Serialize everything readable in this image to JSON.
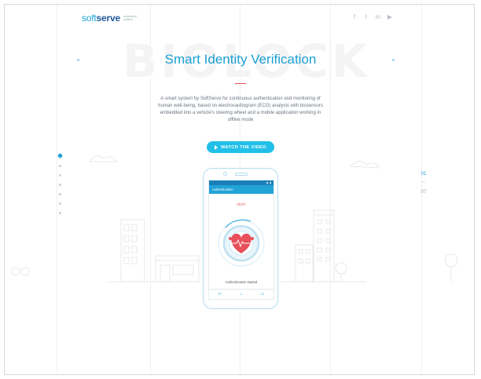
{
  "header": {
    "logo_text_soft": "soft",
    "logo_text_serve": "serve",
    "logo_tagline": "experience matters",
    "social_icons": [
      "facebook-icon",
      "twitter-icon",
      "linkedin-icon",
      "youtube-icon"
    ],
    "social_glyphs": [
      "f",
      "t",
      "in",
      "▶"
    ]
  },
  "hero": {
    "background_word": "BIOLOCK",
    "title": "Smart Identity Verification",
    "description": "A smart system by SoftServe for continuous authentication and monitoring of human well-being, based on electrocardiogram (ECG) analysis with biosensors embedded into a vehicle's steering wheel and a mobile application working in offline mode",
    "cta_label": "WATCH THE VIDEO"
  },
  "slides": {
    "current": "01",
    "separator": "~",
    "total": "07",
    "dot_count": 7,
    "active_index": 0
  },
  "phone": {
    "app_title": "Authentication",
    "timer": "00:07",
    "status_text": "Authentication started",
    "nav_glyphs": [
      "↩",
      "⌂",
      "▭"
    ]
  },
  "colors": {
    "accent": "#1aa0d6",
    "cta": "#22c0e8",
    "heart": "#e8505b",
    "brand_dark": "#1e5a9b"
  }
}
